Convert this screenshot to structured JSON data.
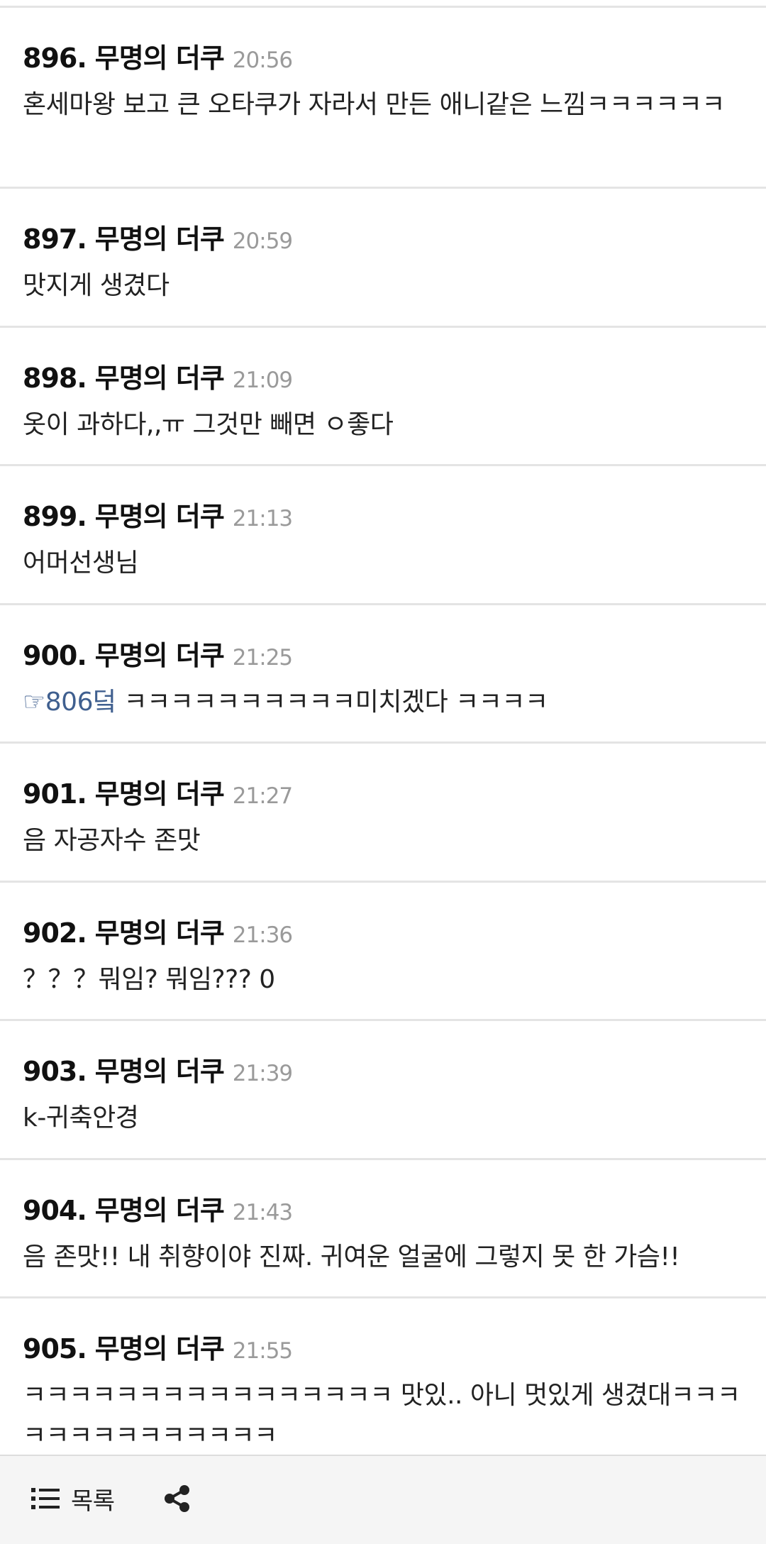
{
  "comments": [
    {
      "number": "896.",
      "author": "무명의 더쿠",
      "time": "20:56",
      "text": "혼세마왕 보고 큰 오타쿠가 자라서 만든 애니같은 느낌ㅋㅋㅋㅋㅋㅋ"
    },
    {
      "number": "897.",
      "author": "무명의 더쿠",
      "time": "20:59",
      "text": "맛지게 생겼다"
    },
    {
      "number": "898.",
      "author": "무명의 더쿠",
      "time": "21:09",
      "text": "옷이 과하다,,ㅠ 그것만 빼면 ㅇ좋다"
    },
    {
      "number": "899.",
      "author": "무명의 더쿠",
      "time": "21:13",
      "text": "어머선생님"
    },
    {
      "number": "900.",
      "author": "무명의 더쿠",
      "time": "21:25",
      "link": "☞806덬",
      "text": " ㅋㅋㅋㅋㅋㅋㅋㅋㅋㅋ미치겠다 ㅋㅋㅋㅋ"
    },
    {
      "number": "901.",
      "author": "무명의 더쿠",
      "time": "21:27",
      "text": "음 자공자수 존맛"
    },
    {
      "number": "902.",
      "author": "무명의 더쿠",
      "time": "21:36",
      "text": "？？？뭐임? 뭐임??? 0"
    },
    {
      "number": "903.",
      "author": "무명의 더쿠",
      "time": "21:39",
      "text": "k-귀축안경"
    },
    {
      "number": "904.",
      "author": "무명의 더쿠",
      "time": "21:43",
      "text": "음 존맛!! 내 취향이야 진짜. 귀여운 얼굴에 그렇지 못 한 가슴!!"
    },
    {
      "number": "905.",
      "author": "무명의 더쿠",
      "time": "21:55",
      "text": "ㅋㅋㅋㅋㅋㅋㅋㅋㅋㅋㅋㅋㅋㅋㅋㅋ 맛있.. 아니 멋있게 생겼대ㅋㅋㅋㅋㅋㅋㅋㅋㅋㅋㅋㅋㅋㅋ"
    }
  ],
  "bottom_bar": {
    "list_label": "목록",
    "list_icon": "list-icon",
    "share_icon": "share-icon"
  },
  "colors": {
    "link": "#3f5f8f",
    "time": "#9a9a9a",
    "divider": "#e4e4e4",
    "bottom_bar_bg": "#f5f5f5"
  }
}
